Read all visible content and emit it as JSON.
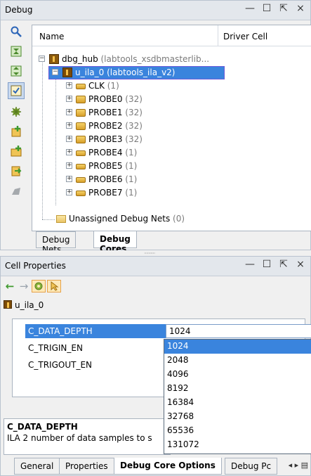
{
  "debug_panel": {
    "title": "Debug",
    "controls": {
      "minimize": "—",
      "maximize": "☐",
      "float": "⇱",
      "close": "×"
    },
    "toolbar_icons": [
      "search-icon",
      "collapse-icon",
      "expand-icon",
      "select-icon",
      "run-icon",
      "add-probe-icon",
      "add-core-icon",
      "export-icon",
      "remove-icon"
    ],
    "columns": {
      "name": "Name",
      "driver": "Driver Cell"
    },
    "tree": {
      "hub": {
        "label": "dbg_hub",
        "sub": " (labtools_xsdbmasterlib..."
      },
      "ila": {
        "label": "u_ila_0",
        "sub": " (labtools_ila_v2)"
      },
      "probes": [
        {
          "label": "CLK",
          "count": " (1)"
        },
        {
          "label": "PROBE0",
          "count": " (32)"
        },
        {
          "label": "PROBE1",
          "count": " (32)"
        },
        {
          "label": "PROBE2",
          "count": " (32)"
        },
        {
          "label": "PROBE3",
          "count": " (32)"
        },
        {
          "label": "PROBE4",
          "count": " (1)"
        },
        {
          "label": "PROBE5",
          "count": " (1)"
        },
        {
          "label": "PROBE6",
          "count": " (1)"
        },
        {
          "label": "PROBE7",
          "count": " (1)"
        }
      ],
      "unassigned": {
        "label": "Unassigned Debug Nets",
        "count": " (0)"
      }
    },
    "tabs": {
      "nets": "Debug Nets",
      "cores": "Debug Cores"
    }
  },
  "splitter": {
    "grip": "··········"
  },
  "cell_panel": {
    "title": "Cell Properties",
    "controls": {
      "minimize": "—",
      "maximize": "☐",
      "float": "⇱",
      "close": "×"
    },
    "nav": {
      "back": "←",
      "forward": "→"
    },
    "object": "u_ila_0",
    "properties": [
      {
        "name": "C_DATA_DEPTH",
        "value": "1024"
      },
      {
        "name": "C_TRIGIN_EN",
        "value": ""
      },
      {
        "name": "C_TRIGOUT_EN",
        "value": ""
      }
    ],
    "dropdown_options": [
      "1024",
      "2048",
      "4096",
      "8192",
      "16384",
      "32768",
      "65536",
      "131072"
    ],
    "description": {
      "title": "C_DATA_DEPTH",
      "text": "ILA 2 number of data samples to s"
    },
    "tabs": {
      "general": "General",
      "properties": "Properties",
      "options": "Debug Core Options",
      "ports": "Debug Pc",
      "arrows": "◂ ▸ ▤"
    }
  }
}
